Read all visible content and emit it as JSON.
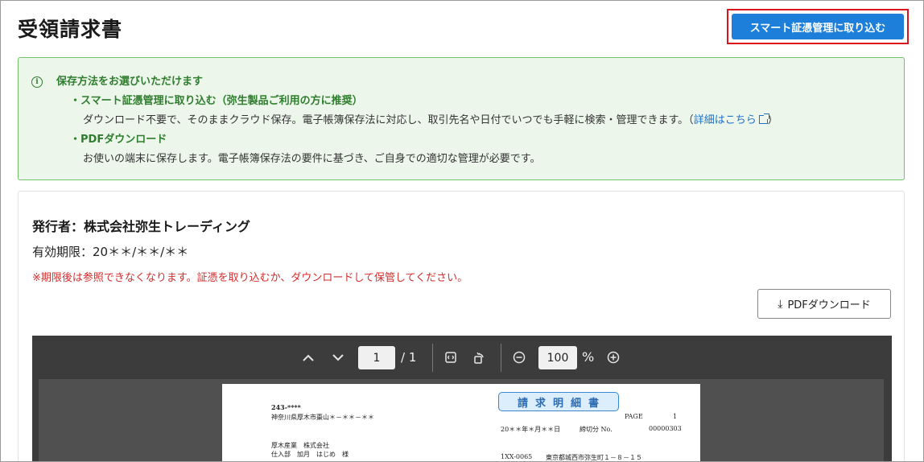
{
  "header": {
    "title": "受領請求書",
    "import_button": "スマート証憑管理に取り込む"
  },
  "notice": {
    "heading": "保存方法をお選びいただけます",
    "option1_title": "・スマート証憑管理に取り込む（弥生製品ご利用の方に推奨）",
    "option1_desc": "ダウンロード不要で、そのままクラウド保存。電子帳簿保存法に対応し、取引先名や日付でいつでも手軽に検索・管理できます。（",
    "option1_link": "詳細はこちら",
    "option1_close": "）",
    "option2_title": "・PDFダウンロード",
    "option2_desc": "お使いの端末に保存します。電子帳簿保存法の要件に基づき、ご自身での適切な管理が必要です。"
  },
  "card": {
    "issuer": "発行者：株式会社弥生トレーディング",
    "expiry": "有効期限：20＊＊/＊＊/＊＊",
    "warning": "※期限後は参照できなくなります。証憑を取り込むか、ダウンロードして保管してください。",
    "download_button": "PDFダウンロード"
  },
  "viewer": {
    "current_page": "1",
    "total_pages": "/ 1",
    "zoom": "100",
    "zoom_unit": "%"
  },
  "document": {
    "zip": "243-****",
    "address": "神奈川県厚木市棗山＊－＊＊－＊＊",
    "customer_company": "厚木産業　株式会社",
    "customer_person": "仕入部　加月　はじめ　様",
    "banner": "請求明細書",
    "page_label": "PAGE",
    "page_number": "1",
    "date": "20＊＊年＊月＊＊日",
    "cutoff": "締切分",
    "number_label": "No.",
    "number": "00000303",
    "code": "1XX-0065",
    "company_address": "東京都城西市弥生町１－８－１５"
  },
  "icons": {
    "info": "info-icon",
    "external_link": "external-link-icon",
    "download": "download-icon",
    "prev_page": "chevron-up-icon",
    "next_page": "chevron-down-icon",
    "fit_page": "fit-page-icon",
    "rotate": "rotate-icon",
    "zoom_out": "zoom-out-icon",
    "zoom_in": "zoom-in-icon"
  },
  "colors": {
    "primary": "#1d7fd9",
    "highlight_border": "#d9151b",
    "notice_bg": "#ecf6ea",
    "notice_border": "#71c268",
    "notice_text": "#2f7d2f",
    "warning": "#d22d2d",
    "viewer_bg": "#3c3c3c"
  }
}
